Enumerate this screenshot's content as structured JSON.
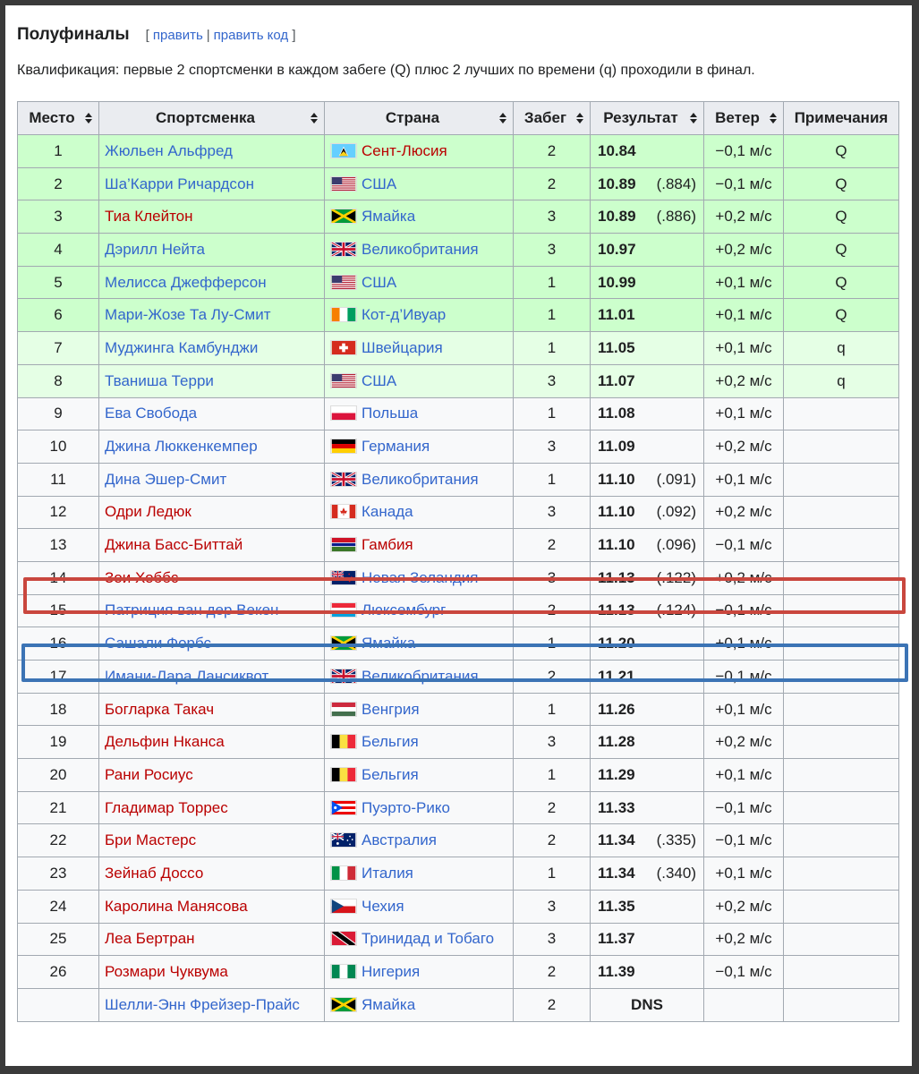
{
  "section": {
    "title": "Полуфиналы",
    "edit_open": "[",
    "edit": "править",
    "sep": "|",
    "edit_code": "править код",
    "edit_close": "]"
  },
  "intro": "Квалификация: первые 2 спортсменки в каждом забеге (Q) плюс 2 лучших по времени (q) проходили в финал.",
  "columns": [
    "Место",
    "Спортсменка",
    "Страна",
    "Забег",
    "Результат",
    "Ветер",
    "Примечания"
  ],
  "rows": [
    {
      "rank": "1",
      "name": "Жюльен Альфред",
      "name_link": "blue",
      "flag": "lc",
      "country": "Сент-Люсия",
      "country_link": "red",
      "heat": "2",
      "result": "10.84",
      "tb": "",
      "wind": "−0,1 м/с",
      "note": "Q",
      "qual": "Q"
    },
    {
      "rank": "2",
      "name": "Ша’Карри Ричардсон",
      "name_link": "blue",
      "flag": "us",
      "country": "США",
      "country_link": "blue",
      "heat": "2",
      "result": "10.89",
      "tb": "(.884)",
      "wind": "−0,1 м/с",
      "note": "Q",
      "qual": "Q"
    },
    {
      "rank": "3",
      "name": "Тиа Клейтон",
      "name_link": "red",
      "flag": "jm",
      "country": "Ямайка",
      "country_link": "blue",
      "heat": "3",
      "result": "10.89",
      "tb": "(.886)",
      "wind": "+0,2 м/с",
      "note": "Q",
      "qual": "Q"
    },
    {
      "rank": "4",
      "name": "Дэрилл Нейта",
      "name_link": "blue",
      "flag": "gb",
      "country": "Великобритания",
      "country_link": "blue",
      "heat": "3",
      "result": "10.97",
      "tb": "",
      "wind": "+0,2 м/с",
      "note": "Q",
      "qual": "Q"
    },
    {
      "rank": "5",
      "name": "Мелисса Джефферсон",
      "name_link": "blue",
      "flag": "us",
      "country": "США",
      "country_link": "blue",
      "heat": "1",
      "result": "10.99",
      "tb": "",
      "wind": "+0,1 м/с",
      "note": "Q",
      "qual": "Q"
    },
    {
      "rank": "6",
      "name": "Мари-Жозе Та Лу-Смит",
      "name_link": "blue",
      "flag": "ci",
      "country": "Кот-д’Ивуар",
      "country_link": "blue",
      "heat": "1",
      "result": "11.01",
      "tb": "",
      "wind": "+0,1 м/с",
      "note": "Q",
      "qual": "Q"
    },
    {
      "rank": "7",
      "name": "Муджинга Камбунджи",
      "name_link": "blue",
      "flag": "ch",
      "country": "Швейцария",
      "country_link": "blue",
      "heat": "1",
      "result": "11.05",
      "tb": "",
      "wind": "+0,1 м/с",
      "note": "q",
      "qual": "q"
    },
    {
      "rank": "8",
      "name": "Тваниша Терри",
      "name_link": "blue",
      "flag": "us",
      "country": "США",
      "country_link": "blue",
      "heat": "3",
      "result": "11.07",
      "tb": "",
      "wind": "+0,2 м/с",
      "note": "q",
      "qual": "q"
    },
    {
      "rank": "9",
      "name": "Ева Свобода",
      "name_link": "blue",
      "flag": "pl",
      "country": "Польша",
      "country_link": "blue",
      "heat": "1",
      "result": "11.08",
      "tb": "",
      "wind": "+0,1 м/с",
      "note": "",
      "qual": ""
    },
    {
      "rank": "10",
      "name": "Джина Люккенкемпер",
      "name_link": "blue",
      "flag": "de",
      "country": "Германия",
      "country_link": "blue",
      "heat": "3",
      "result": "11.09",
      "tb": "",
      "wind": "+0,2 м/с",
      "note": "",
      "qual": ""
    },
    {
      "rank": "11",
      "name": "Дина Эшер-Смит",
      "name_link": "blue",
      "flag": "gb",
      "country": "Великобритания",
      "country_link": "blue",
      "heat": "1",
      "result": "11.10",
      "tb": "(.091)",
      "wind": "+0,1 м/с",
      "note": "",
      "qual": ""
    },
    {
      "rank": "12",
      "name": "Одри Ледюк",
      "name_link": "red",
      "flag": "ca",
      "country": "Канада",
      "country_link": "blue",
      "heat": "3",
      "result": "11.10",
      "tb": "(.092)",
      "wind": "+0,2 м/с",
      "note": "",
      "qual": ""
    },
    {
      "rank": "13",
      "name": "Джина Басс-Биттай",
      "name_link": "red",
      "flag": "gm",
      "country": "Гамбия",
      "country_link": "red",
      "heat": "2",
      "result": "11.10",
      "tb": "(.096)",
      "wind": "−0,1 м/с",
      "note": "",
      "qual": ""
    },
    {
      "rank": "14",
      "name": "Зои Хоббс",
      "name_link": "red",
      "flag": "nz",
      "country": "Новая Зеландия",
      "country_link": "blue",
      "heat": "3",
      "result": "11.13",
      "tb": "(.122)",
      "wind": "+0,2 м/с",
      "note": "",
      "qual": ""
    },
    {
      "rank": "15",
      "name": "Патриция ван дер Векен",
      "name_link": "blue",
      "flag": "lu",
      "country": "Люксембург",
      "country_link": "blue",
      "heat": "2",
      "result": "11.13",
      "tb": "(.124)",
      "wind": "−0,1 м/с",
      "note": "",
      "qual": ""
    },
    {
      "rank": "16",
      "name": "Сашали Форбс",
      "name_link": "blue",
      "flag": "jm",
      "country": "Ямайка",
      "country_link": "blue",
      "heat": "1",
      "result": "11.20",
      "tb": "",
      "wind": "+0,1 м/с",
      "note": "",
      "qual": ""
    },
    {
      "rank": "17",
      "name": "Имани-Лара Лансиквот",
      "name_link": "blue",
      "flag": "gb",
      "country": "Великобритания",
      "country_link": "blue",
      "heat": "2",
      "result": "11.21",
      "tb": "",
      "wind": "−0,1 м/с",
      "note": "",
      "qual": ""
    },
    {
      "rank": "18",
      "name": "Богларка Такач",
      "name_link": "red",
      "flag": "hu",
      "country": "Венгрия",
      "country_link": "blue",
      "heat": "1",
      "result": "11.26",
      "tb": "",
      "wind": "+0,1 м/с",
      "note": "",
      "qual": ""
    },
    {
      "rank": "19",
      "name": "Дельфин Нканса",
      "name_link": "red",
      "flag": "be",
      "country": "Бельгия",
      "country_link": "blue",
      "heat": "3",
      "result": "11.28",
      "tb": "",
      "wind": "+0,2 м/с",
      "note": "",
      "qual": ""
    },
    {
      "rank": "20",
      "name": "Рани Росиус",
      "name_link": "red",
      "flag": "be",
      "country": "Бельгия",
      "country_link": "blue",
      "heat": "1",
      "result": "11.29",
      "tb": "",
      "wind": "+0,1 м/с",
      "note": "",
      "qual": ""
    },
    {
      "rank": "21",
      "name": "Гладимар Торрес",
      "name_link": "red",
      "flag": "pr",
      "country": "Пуэрто-Рико",
      "country_link": "blue",
      "heat": "2",
      "result": "11.33",
      "tb": "",
      "wind": "−0,1 м/с",
      "note": "",
      "qual": ""
    },
    {
      "rank": "22",
      "name": "Бри Мастерс",
      "name_link": "red",
      "flag": "au",
      "country": "Австралия",
      "country_link": "blue",
      "heat": "2",
      "result": "11.34",
      "tb": "(.335)",
      "wind": "−0,1 м/с",
      "note": "",
      "qual": ""
    },
    {
      "rank": "23",
      "name": "Зейнаб Доссо",
      "name_link": "red",
      "flag": "it",
      "country": "Италия",
      "country_link": "blue",
      "heat": "1",
      "result": "11.34",
      "tb": "(.340)",
      "wind": "+0,1 м/с",
      "note": "",
      "qual": ""
    },
    {
      "rank": "24",
      "name": "Каролина Манясова",
      "name_link": "red",
      "flag": "cz",
      "country": "Чехия",
      "country_link": "blue",
      "heat": "3",
      "result": "11.35",
      "tb": "",
      "wind": "+0,2 м/с",
      "note": "",
      "qual": ""
    },
    {
      "rank": "25",
      "name": "Леа Бертран",
      "name_link": "red",
      "flag": "tt",
      "country": "Тринидад и Тобаго",
      "country_link": "blue",
      "heat": "3",
      "result": "11.37",
      "tb": "",
      "wind": "+0,2 м/с",
      "note": "",
      "qual": ""
    },
    {
      "rank": "26",
      "name": "Розмари Чуквума",
      "name_link": "red",
      "flag": "ng",
      "country": "Нигерия",
      "country_link": "blue",
      "heat": "2",
      "result": "11.39",
      "tb": "",
      "wind": "−0,1 м/с",
      "note": "",
      "qual": ""
    },
    {
      "rank": "",
      "name": "Шелли-Энн Фрейзер-Прайс",
      "name_link": "blue",
      "flag": "jm",
      "country": "Ямайка",
      "country_link": "blue",
      "heat": "2",
      "result": "DNS",
      "tb": "",
      "wind": "",
      "note": "",
      "qual": ""
    }
  ],
  "highlights": {
    "red_row_rank": "14",
    "blue_row_rank": "16",
    "red_color": "#c9473e",
    "blue_color": "#3c74b5"
  },
  "colors": {
    "qualified_Q": "#ccffcc",
    "qualified_q": "#e5ffe5",
    "link_blue": "#3366cc",
    "link_red": "#ba0000"
  }
}
